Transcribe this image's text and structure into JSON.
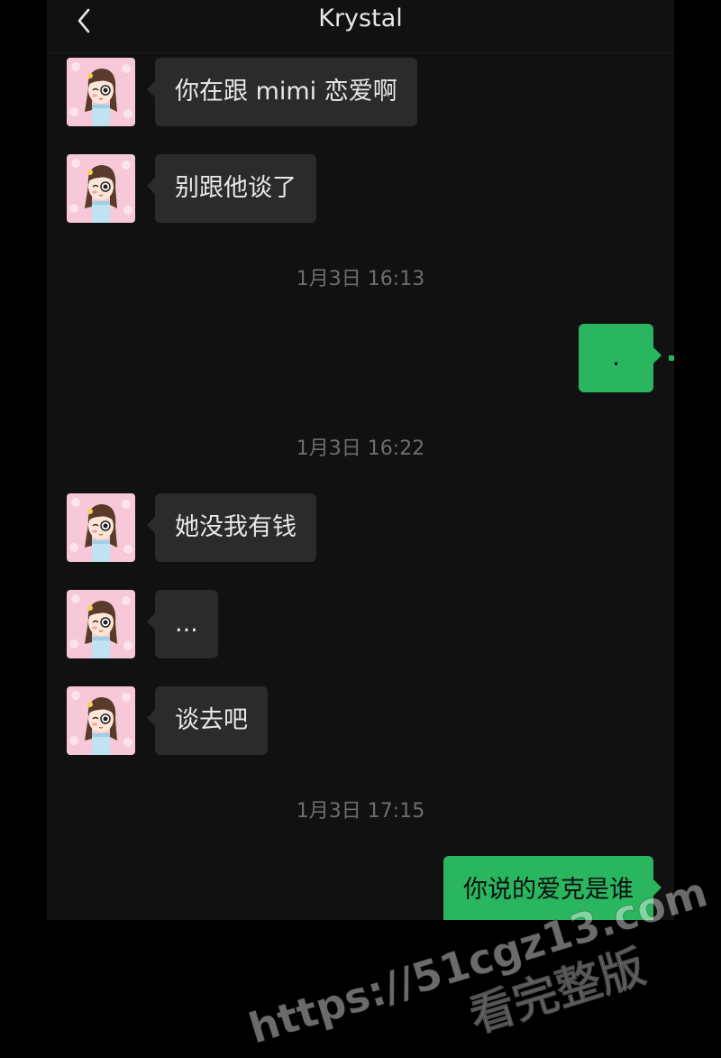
{
  "header": {
    "title": "Krystal"
  },
  "messages": [
    {
      "text": "你在跟 mimi 恋爱啊"
    },
    {
      "text": "别跟他谈了"
    },
    {
      "text": "."
    },
    {
      "text": "她没我有钱"
    },
    {
      "text": "..."
    },
    {
      "text": "谈去吧"
    },
    {
      "text": "你说的爱克是谁"
    }
  ],
  "timestamps": [
    "1月3日 16:13",
    "1月3日 16:22",
    "1月3日 17:15"
  ],
  "watermark": {
    "url": "https://51cgz13.com",
    "caption": "看完整版"
  },
  "colors": {
    "background": "#111111",
    "incoming_bubble": "#2b2b2b",
    "outgoing_bubble": "#2ab55f",
    "timestamp": "#6e6e6e"
  },
  "icons": {
    "back": "chevron-left-icon",
    "avatar": "avatar-girl-illustration"
  }
}
